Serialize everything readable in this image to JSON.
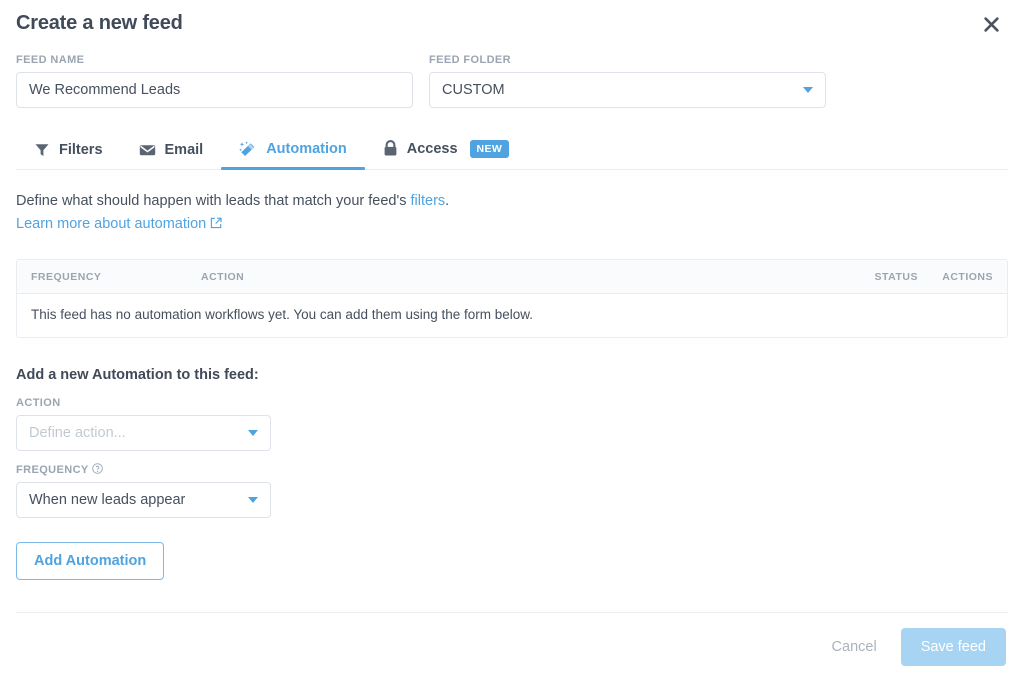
{
  "header": {
    "title": "Create a new feed",
    "close_icon": "close-icon"
  },
  "fields": {
    "feed_name": {
      "label": "FEED NAME",
      "value": "We Recommend Leads"
    },
    "feed_folder": {
      "label": "FEED FOLDER",
      "value": "CUSTOM",
      "caret_icon": "chevron-down-icon"
    }
  },
  "tabs": [
    {
      "label": "Filters",
      "icon": "funnel-icon",
      "active": false,
      "badge": ""
    },
    {
      "label": "Email",
      "icon": "envelope-icon",
      "active": false,
      "badge": ""
    },
    {
      "label": "Automation",
      "icon": "magic-wand-icon",
      "active": true,
      "badge": ""
    },
    {
      "label": "Access",
      "icon": "lock-icon",
      "active": false,
      "badge": "NEW"
    }
  ],
  "intro": {
    "text_before": "Define what should happen with leads that match your feed's ",
    "filters_link": "filters",
    "text_after": ".",
    "learn_more": "Learn more about automation",
    "external_icon": "external-link-icon"
  },
  "table": {
    "columns": [
      "FREQUENCY",
      "ACTION",
      "STATUS",
      "ACTIONS"
    ],
    "rows": [],
    "empty_message": "This feed has no automation workflows yet. You can add them using the form below."
  },
  "add_automation": {
    "title": "Add a new Automation to this feed:",
    "action": {
      "label": "ACTION",
      "placeholder": "Define action...",
      "value": ""
    },
    "frequency": {
      "label": "FREQUENCY",
      "help_icon": "question-circle-icon",
      "value": "When new leads appear"
    },
    "submit_label": "Add Automation"
  },
  "footer": {
    "cancel_label": "Cancel",
    "save_label": "Save feed"
  },
  "colors": {
    "accent": "#4ea3e0",
    "save_disabled": "#a6d4f2",
    "text": "#46505e",
    "muted": "#9aa5b1",
    "border": "#e9edf1"
  }
}
